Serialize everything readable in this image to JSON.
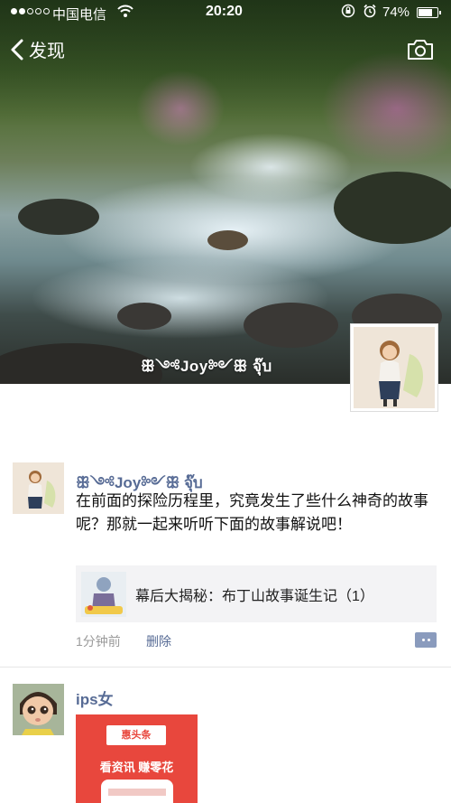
{
  "status_bar": {
    "carrier": "中国电信",
    "time": "20:20",
    "battery_percent_text": "74%",
    "battery_level": 0.74,
    "signal_bars_on": 2,
    "signal_bars_total": 5
  },
  "nav": {
    "back_label": "发现",
    "camera_icon": "camera-icon"
  },
  "cover": {
    "display_name": "ꕥ༺Joy༻ꕥ จุ๊บ"
  },
  "posts": [
    {
      "author": "ꕥ༺Joy༻ꕥ จุ๊บ",
      "text": "在前面的探险历程里，究竟发生了些什么神奇的故事呢？那就一起来听听下面的故事解说吧！",
      "share": {
        "title": "幕后大揭秘：布丁山故事诞生记（1）"
      },
      "time": "1分钟前",
      "delete_label": "删除"
    },
    {
      "author": "ips女",
      "ad": {
        "logo_text": "惠头条",
        "slogan": "看资讯  赚零花"
      }
    }
  ],
  "colors": {
    "link_blue": "#576b95",
    "meta_gray": "#9a9a9a",
    "card_bg": "#f3f3f5",
    "ad_red": "#e8473d"
  }
}
